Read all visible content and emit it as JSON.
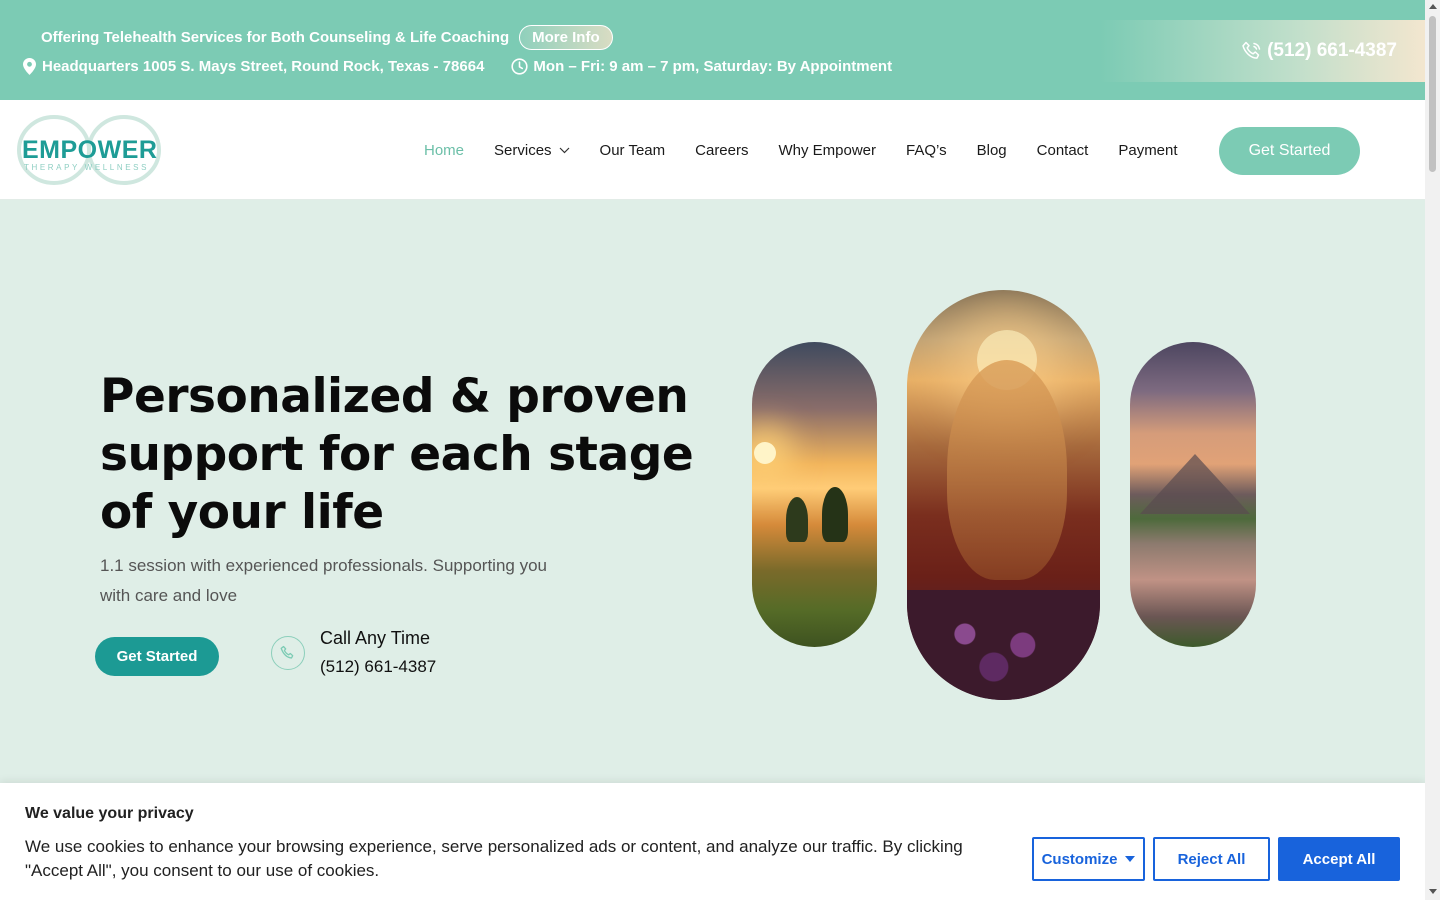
{
  "topbar": {
    "telehealth_text": "Offering Telehealth Services for Both Counseling & Life Coaching",
    "more_info_label": "More Info",
    "address_text": "Headquarters 1005 S. Mays Street, Round Rock, Texas - 78664",
    "hours_text": "Mon – Fri: 9 am – 7 pm, Saturday: By Appointment",
    "phone_text": "(512) 661-4387"
  },
  "header": {
    "logo_word": "EMPOWER",
    "logo_sub": "THERAPY WELLNESS",
    "nav": [
      {
        "label": "Home",
        "active": true
      },
      {
        "label": "Services",
        "has_dropdown": true
      },
      {
        "label": "Our Team"
      },
      {
        "label": "Careers"
      },
      {
        "label": "Why Empower"
      },
      {
        "label": "FAQ’s"
      },
      {
        "label": "Blog"
      },
      {
        "label": "Contact"
      },
      {
        "label": "Payment"
      }
    ],
    "cta_label": "Get Started"
  },
  "hero": {
    "title": "Personalized & proven support for each stage of your life",
    "subtitle": "1.1 session with experienced professionals. Supporting you with care and love",
    "cta_label": "Get Started",
    "call_label": "Call Any Time",
    "call_number": "(512) 661-4387"
  },
  "cookie": {
    "title": "We value your privacy",
    "text": "We use cookies to enhance your browsing experience, serve personalized ads or content, and analyze our traffic. By clicking \"Accept All\", you consent to our use of cookies.",
    "customize_label": "Customize",
    "reject_label": "Reject All",
    "accept_label": "Accept All"
  },
  "colors": {
    "brand_mint": "#7ccbb4",
    "brand_teal": "#1c9a94",
    "hero_bg": "#dfeee7",
    "cookie_blue": "#1863dc"
  }
}
